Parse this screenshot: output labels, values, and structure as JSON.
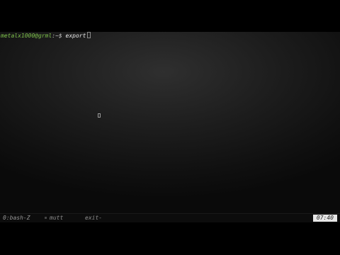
{
  "terminal": {
    "prompt": "metalx1000@grml",
    "prompt_separator": ":~$",
    "command": "export"
  },
  "statusbar": {
    "tabs": [
      {
        "label": "0:bash-Z"
      },
      {
        "label": "mutt"
      },
      {
        "label": "exit-"
      }
    ],
    "clock": "07:40"
  },
  "colors": {
    "prompt_user": "#7fc34c",
    "background": "#000000",
    "clock_bg": "#e6e6e6"
  }
}
